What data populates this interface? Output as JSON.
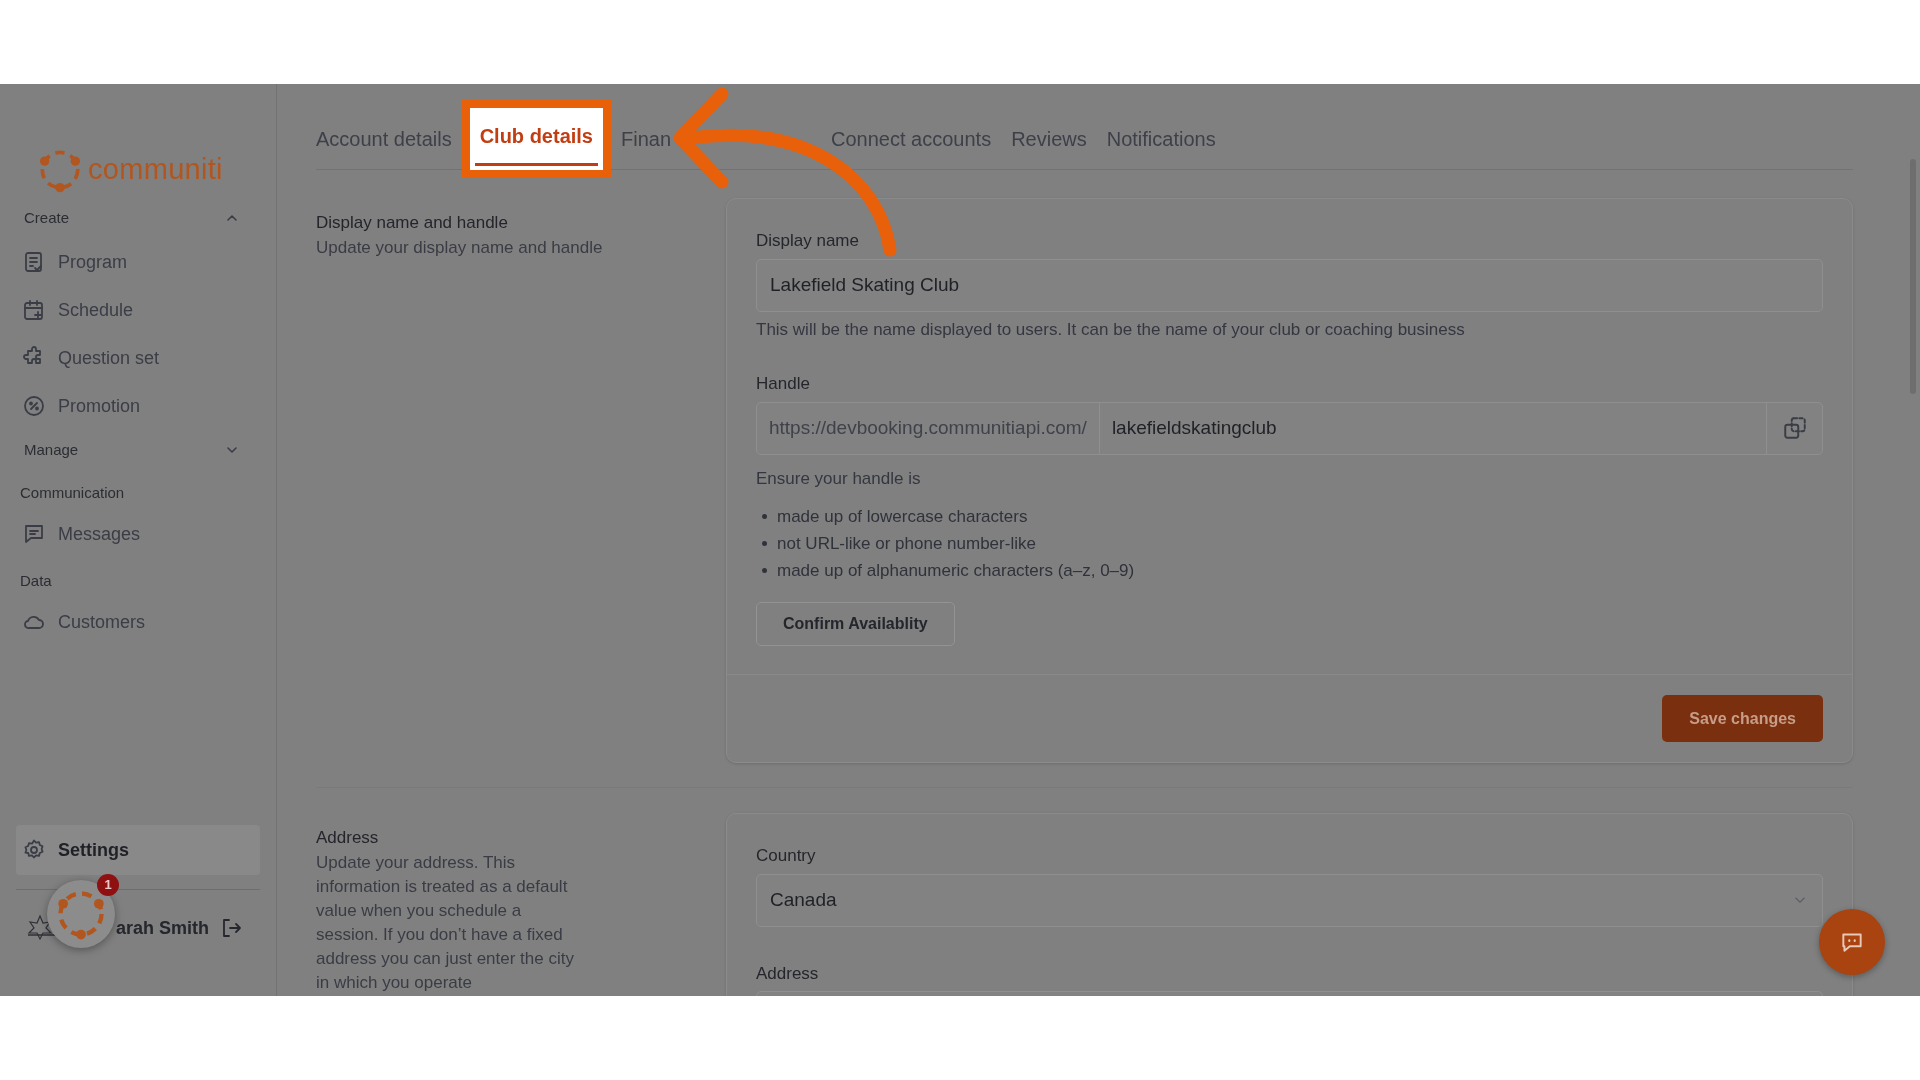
{
  "sidebar": {
    "brand": "communiti",
    "groups": [
      {
        "kind": "collapsible",
        "label": "Create",
        "expanded": true,
        "items": [
          {
            "label": "Program"
          },
          {
            "label": "Schedule"
          },
          {
            "label": "Question set"
          },
          {
            "label": "Promotion"
          }
        ]
      },
      {
        "kind": "collapsible",
        "label": "Manage",
        "expanded": false
      },
      {
        "kind": "heading",
        "label": "Communication",
        "items": [
          {
            "label": "Messages"
          }
        ]
      },
      {
        "kind": "heading",
        "label": "Data",
        "items": [
          {
            "label": "Customers"
          }
        ]
      }
    ],
    "settings": {
      "label": "Settings",
      "selected": true
    },
    "user": {
      "name": "arah Smith"
    },
    "loader": {
      "badge": "1"
    }
  },
  "tabs": [
    {
      "label": "Account details",
      "selected": false
    },
    {
      "label": "Club details",
      "selected": true
    },
    {
      "label": "Finan",
      "selected": false
    },
    {
      "label": "Connect accounts",
      "selected": false
    },
    {
      "label": "Reviews",
      "selected": false
    },
    {
      "label": "Notifications",
      "selected": false
    }
  ],
  "display_section": {
    "title": "Display name and handle",
    "description": "Update your display name and handle",
    "display_name": {
      "label": "Display name",
      "value": "Lakefield Skating Club",
      "help": "This will be the name displayed to users. It can be the name of your club or coaching business"
    },
    "handle": {
      "label": "Handle",
      "prefix": "https://devbooking.communitiapi.com/",
      "value": "lakefieldskatingclub"
    },
    "rules_intro": "Ensure your handle is",
    "rules": [
      "made up of lowercase characters",
      "not URL-like or phone number-like",
      "made up of alphanumeric characters (a–z, 0–9)"
    ],
    "confirm_button": "Confirm Availablity",
    "save_button": "Save changes"
  },
  "address_section": {
    "title": "Address",
    "description": "Update your address. This information is treated as a default value when you schedule a session. If you don’t have a fixed address you can just enter the city in which you operate",
    "country": {
      "label": "Country",
      "value": "Canada"
    },
    "address": {
      "label": "Address"
    }
  }
}
